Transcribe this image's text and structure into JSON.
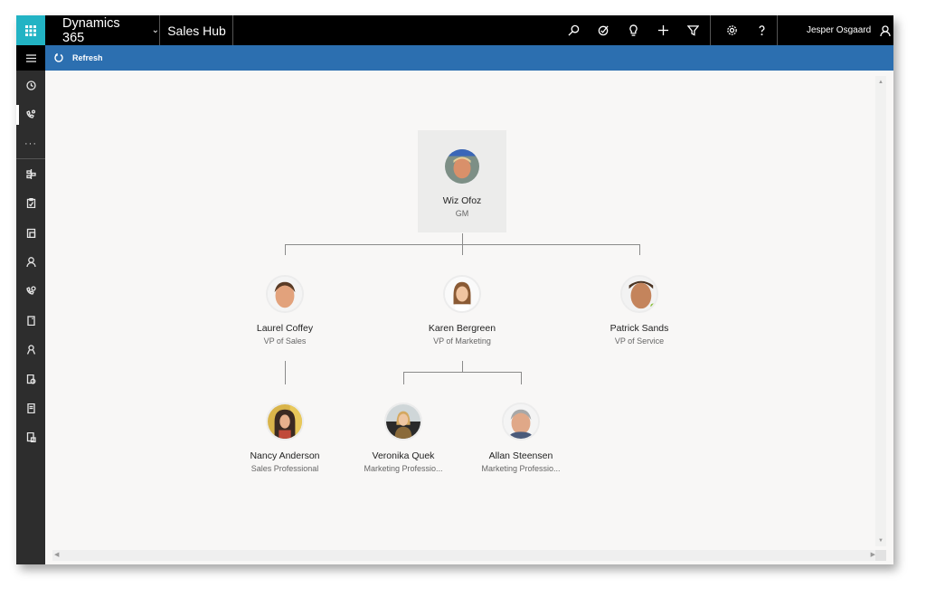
{
  "topbar": {
    "app_name": "Dynamics 365",
    "hub_name": "Sales Hub",
    "user_name": "Jesper Osgaard",
    "icons": [
      "search-icon",
      "task-icon",
      "lightbulb-icon",
      "plus-icon",
      "filter-icon",
      "gear-icon",
      "help-icon"
    ]
  },
  "commandbar": {
    "refresh_label": "Refresh"
  },
  "sidebar": {
    "items": [
      {
        "icon": "recent-icon"
      },
      {
        "icon": "pinned-contacts-icon",
        "active": true
      },
      {
        "icon": "more-icon",
        "label": "···"
      },
      {
        "icon": "dashboard-icon"
      },
      {
        "icon": "activities-icon"
      },
      {
        "icon": "accounts-icon"
      },
      {
        "icon": "contacts-icon"
      },
      {
        "icon": "leads-icon"
      },
      {
        "icon": "opportunities-icon"
      },
      {
        "icon": "competitors-icon"
      },
      {
        "icon": "quotes-icon"
      },
      {
        "icon": "orders-icon"
      },
      {
        "icon": "invoices-icon"
      }
    ]
  },
  "orgchart": {
    "root": {
      "name": "Wiz Ofoz",
      "title": "GM"
    },
    "level1": [
      {
        "name": "Laurel Coffey",
        "title": "VP of Sales"
      },
      {
        "name": "Karen Bergreen",
        "title": "VP of Marketing"
      },
      {
        "name": "Patrick Sands",
        "title": "VP of Service"
      }
    ],
    "level2": [
      {
        "name": "Nancy Anderson",
        "title": "Sales Professional",
        "manager": "Laurel Coffey"
      },
      {
        "name": "Veronika Quek",
        "title": "Marketing Professio...",
        "manager": "Karen Bergreen"
      },
      {
        "name": "Allan Steensen",
        "title": "Marketing Professio...",
        "manager": "Karen Bergreen"
      }
    ]
  },
  "colors": {
    "waffle": "#22b3c4",
    "topbar": "#000000",
    "commandbar": "#2c6fb0",
    "sidebar": "#2d2d2d",
    "content_bg": "#f8f7f6"
  }
}
